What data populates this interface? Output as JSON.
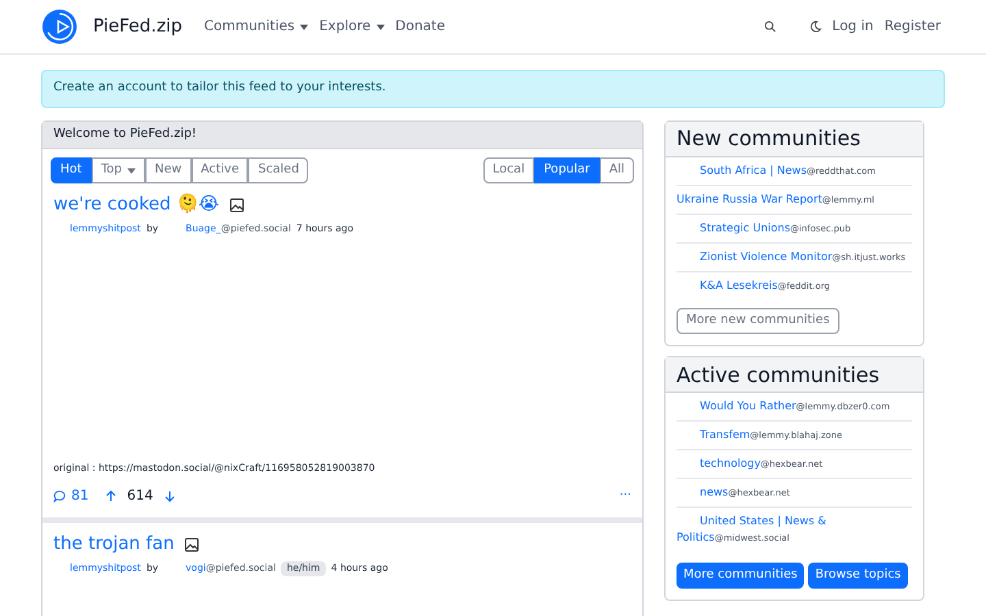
{
  "navbar": {
    "brand": "PieFed.zip",
    "links": [
      {
        "label": "Communities",
        "dropdown": true
      },
      {
        "label": "Explore",
        "dropdown": true
      },
      {
        "label": "Donate",
        "dropdown": false
      }
    ],
    "login": "Log in",
    "register": "Register"
  },
  "alert": "Create an account to tailor this feed to your interests.",
  "feed": {
    "title": "Welcome to PieFed.zip!",
    "sort_tabs": [
      {
        "label": "Hot",
        "selected": true,
        "dropdown": false
      },
      {
        "label": "Top",
        "selected": false,
        "dropdown": true
      },
      {
        "label": "New",
        "selected": false,
        "dropdown": false
      },
      {
        "label": "Active",
        "selected": false,
        "dropdown": false
      },
      {
        "label": "Scaled",
        "selected": false,
        "dropdown": false
      }
    ],
    "scope_tabs": [
      {
        "label": "Local",
        "selected": false
      },
      {
        "label": "Popular",
        "selected": true
      },
      {
        "label": "All",
        "selected": false
      }
    ],
    "posts": [
      {
        "title": "we're cooked 🫠😭",
        "community": "lemmyshitpost",
        "by": "by",
        "author": "Buage_",
        "instance": "@piefed.social",
        "time": "7 hours ago",
        "image_area": true,
        "body": "original : https://mastodon.social/@nixCraft/116958052819003870",
        "comments": "81",
        "score": "614",
        "more": "···"
      },
      {
        "title": "the trojan fan",
        "community": "lemmyshitpost",
        "by": "by",
        "author": "vogi",
        "instance": "@piefed.social",
        "flair": "he/him",
        "time": "4 hours ago",
        "image_area": false
      }
    ]
  },
  "new_communities": {
    "title": "New communities",
    "items": [
      {
        "name": "South Africa | News",
        "instance": "@reddthat.com",
        "has_avatar": true
      },
      {
        "name": "Ukraine Russia War Report",
        "instance": "@lemmy.ml",
        "has_avatar": false
      },
      {
        "name": "Strategic Unions",
        "instance": "@infosec.pub",
        "has_avatar": true
      },
      {
        "name": "Zionist Violence Monitor",
        "instance": "@sh.itjust.works",
        "has_avatar": true
      },
      {
        "name": "K&A Lesekreis",
        "instance": "@feddit.org",
        "has_avatar": true
      }
    ],
    "button": "More new communities"
  },
  "active_communities": {
    "title": "Active communities",
    "items": [
      {
        "name": "Would You Rather",
        "instance": "@lemmy.dbzer0.com",
        "has_avatar": true
      },
      {
        "name": "Transfem",
        "instance": "@lemmy.blahaj.zone",
        "has_avatar": true
      },
      {
        "name": "technology",
        "instance": "@hexbear.net",
        "has_avatar": true
      },
      {
        "name": "news",
        "instance": "@hexbear.net",
        "has_avatar": true
      },
      {
        "name": "United States | News & Politics",
        "instance": "@midwest.social",
        "has_avatar": true
      }
    ],
    "buttons": [
      "More communities",
      "Browse topics"
    ]
  }
}
